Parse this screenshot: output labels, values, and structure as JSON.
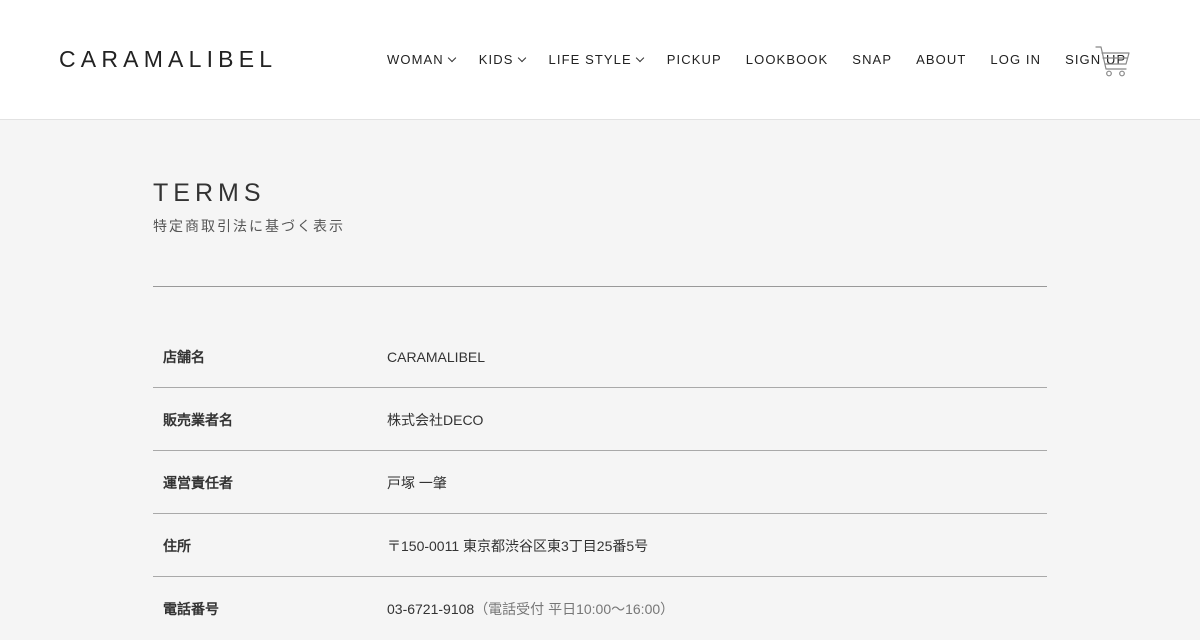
{
  "header": {
    "logo": "CARAMALIBEL",
    "nav": [
      {
        "label": "WOMAN",
        "has_dropdown": true
      },
      {
        "label": "KIDS",
        "has_dropdown": true
      },
      {
        "label": "LIFE STYLE",
        "has_dropdown": true
      },
      {
        "label": "PICKUP",
        "has_dropdown": false
      },
      {
        "label": "LOOKBOOK",
        "has_dropdown": false
      },
      {
        "label": "SNAP",
        "has_dropdown": false
      },
      {
        "label": "ABOUT",
        "has_dropdown": false
      },
      {
        "label": "LOG IN",
        "has_dropdown": false
      },
      {
        "label": "SIGN UP",
        "has_dropdown": false
      }
    ],
    "cart_icon": "shopping-cart-icon"
  },
  "page": {
    "title": "TERMS",
    "subtitle": "特定商取引法に基づく表示"
  },
  "terms": [
    {
      "label": "店舗名",
      "value": "CARAMALIBEL",
      "note": ""
    },
    {
      "label": "販売業者名",
      "value": "株式会社DECO",
      "note": ""
    },
    {
      "label": "運営責任者",
      "value": "戸塚 一肇",
      "note": ""
    },
    {
      "label": "住所",
      "value": "〒150-0011 東京都渋谷区東3丁目25番5号",
      "note": ""
    },
    {
      "label": "電話番号",
      "value": "03-6721-9108",
      "note": "（電話受付 平日10:00〜16:00）"
    }
  ],
  "colors": {
    "page_background": "#f5f5f5",
    "header_background": "#ffffff",
    "text": "#333333",
    "rule": "#a9a9a9"
  }
}
